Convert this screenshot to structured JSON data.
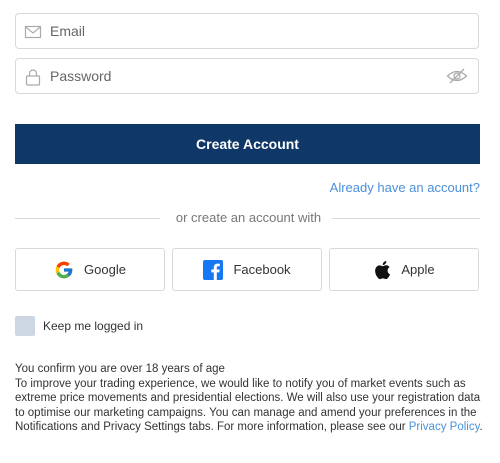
{
  "email_field": {
    "placeholder": "Email",
    "icon": "envelope-icon"
  },
  "password_field": {
    "placeholder": "Password",
    "icon": "lock-icon",
    "toggle_icon": "eye-off-icon"
  },
  "primary_button": {
    "label": "Create Account",
    "color": "#0f3768"
  },
  "signin_link": {
    "label": "Already have an account?"
  },
  "divider": {
    "label": "or create an account with"
  },
  "social_buttons": [
    {
      "label": "Google",
      "icon": "google-logo-icon"
    },
    {
      "label": "Facebook",
      "icon": "facebook-logo-icon"
    },
    {
      "label": "Apple",
      "icon": "apple-logo-icon"
    }
  ],
  "keep_logged_in": {
    "label": "Keep me logged in",
    "checked": false
  },
  "legal": {
    "age": "You confirm you are over 18 years of age",
    "notice": "To improve your trading experience, we would like to notify you of market events such as extreme price movements and presidential elections. We will also use your registration data to optimise our marketing campaigns. You can manage and amend your preferences in the Notifications and Privacy Settings tabs. For more information, please see our",
    "privacy_link": "Privacy Policy",
    "end": "."
  },
  "colors": {
    "link": "#4a90d9",
    "border": "#d9d9d9",
    "checkbox": "#cdd7e3"
  }
}
